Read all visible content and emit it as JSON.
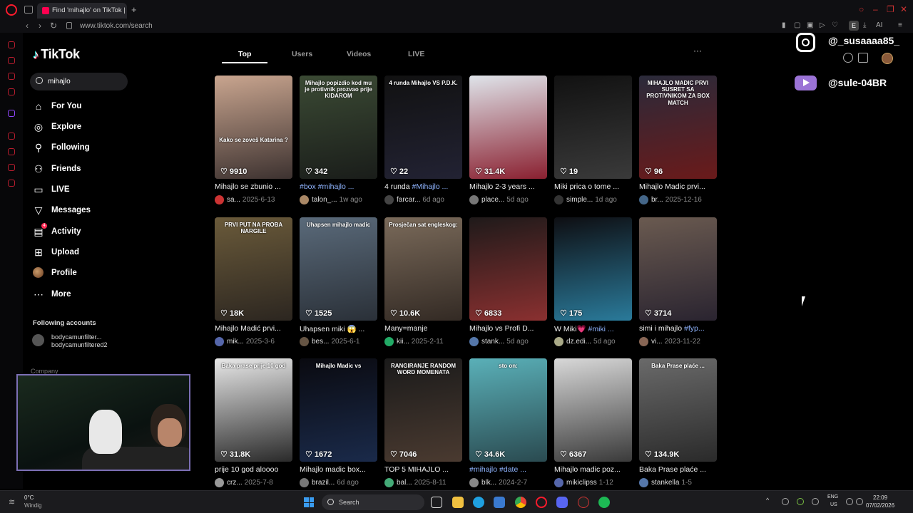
{
  "browser": {
    "tab_title": "Find 'mihajlo' on TikTok | T",
    "new_tab_symbol": "+",
    "url": "www.tiktok.com/search",
    "ext_label": "E",
    "ai_label": "AI"
  },
  "tiktok": {
    "logo_text": "TikTok",
    "search_value": "mihajlo",
    "nav": [
      {
        "label": "For You",
        "icon": "home-icon"
      },
      {
        "label": "Explore",
        "icon": "compass-icon"
      },
      {
        "label": "Following",
        "icon": "following-icon"
      },
      {
        "label": "Friends",
        "icon": "friends-icon"
      },
      {
        "label": "LIVE",
        "icon": "live-icon"
      },
      {
        "label": "Messages",
        "icon": "messages-icon"
      },
      {
        "label": "Activity",
        "icon": "activity-icon",
        "badge": "4"
      },
      {
        "label": "Upload",
        "icon": "upload-icon"
      },
      {
        "label": "Profile",
        "icon": "profile-avatar"
      },
      {
        "label": "More",
        "icon": "more-icon"
      }
    ],
    "following_title": "Following accounts",
    "following_account": {
      "name": "bodycamunfilter...",
      "handle": "bodycamunfiltered2"
    },
    "company_label": "Company",
    "tabs": [
      "Top",
      "Users",
      "Videos",
      "LIVE"
    ],
    "active_tab": "Top",
    "more_label": "···"
  },
  "videos": [
    {
      "likes": "9910",
      "title": "Mihajlo se zbunio ...",
      "tag": "",
      "author": "sa...",
      "date": "2025-6-13",
      "overlay": "Kako se zoveš Katarina ?",
      "colors": [
        "#c9a58f",
        "#3d3230"
      ],
      "ava": "#c33"
    },
    {
      "likes": "342",
      "title": "",
      "tag": "#box #mihajlo ...",
      "author": "talon_...",
      "date": "1w ago",
      "overlay": "Mihajlo popizdio kod mu je protivnik prozvao prije KIDAROM",
      "colors": [
        "#3b4a34",
        "#1a1d1a"
      ],
      "ava": "#a86"
    },
    {
      "likes": "22",
      "title": "4 runda ",
      "tag": "#Mihajlo ...",
      "author": "farcar...",
      "date": "6d ago",
      "overlay": "4 runda Mihajlo VS P.D.K.",
      "colors": [
        "#111",
        "#223"
      ],
      "ava": "#444"
    },
    {
      "likes": "31.4K",
      "title": "Mihajlo 2-3 years ...",
      "tag": "",
      "author": "place...",
      "date": "5d ago",
      "overlay": "",
      "colors": [
        "#dfe4ea",
        "#8a2030"
      ],
      "ava": "#777"
    },
    {
      "likes": "19",
      "title": "Miki prica o tome ...",
      "tag": "",
      "author": "simple...",
      "date": "1d ago",
      "overlay": "",
      "colors": [
        "#111",
        "#3a3a3a"
      ],
      "ava": "#333"
    },
    {
      "likes": "96",
      "title": "Mihajlo Madic prvi...",
      "tag": "",
      "author": "br...",
      "date": "2025-12-16",
      "overlay": "MIHAJLO MADIC PRVI SUSRET SA PROTIVNIKOM ZA BOX MATCH",
      "colors": [
        "#2a2a3a",
        "#6a1a1a"
      ],
      "ava": "#468"
    },
    {
      "likes": "18K",
      "title": "Mihajlo Madić prvi...",
      "tag": "",
      "author": "mik...",
      "date": "2025-3-6",
      "overlay": "PRVI PUT NA PROBA NARGILE",
      "colors": [
        "#6a5a3a",
        "#2c2620"
      ],
      "ava": "#56a"
    },
    {
      "likes": "1525",
      "title": "Uhapsen miki 😱 ...",
      "tag": "",
      "author": "bes...",
      "date": "2025-6-1",
      "overlay": "Uhapsen mihajlo madic",
      "colors": [
        "#5a6a7a",
        "#2a3038"
      ],
      "ava": "#654"
    },
    {
      "likes": "10.6K",
      "title": "Many=manje",
      "tag": "",
      "author": "kii...",
      "date": "2025-2-11",
      "overlay": "Prosječan sat engleskog:",
      "colors": [
        "#7a6a5a",
        "#332a24"
      ],
      "ava": "#2a6"
    },
    {
      "likes": "6833",
      "title": "Mihajlo vs Profi D...",
      "tag": "",
      "author": "stank...",
      "date": "5d ago",
      "overlay": "",
      "colors": [
        "#1f1a1a",
        "#8a3030"
      ],
      "ava": "#57a"
    },
    {
      "likes": "175",
      "title": "W Miki💗 ",
      "tag": "#miki ...",
      "author": "dz.edi...",
      "date": "5d ago",
      "overlay": "",
      "colors": [
        "#0e0e12",
        "#2a7a9a"
      ],
      "ava": "#aa8"
    },
    {
      "likes": "3714",
      "title": "simi i mihajlo ",
      "tag": "#fyp...",
      "author": "vi...",
      "date": "2023-11-22",
      "overlay": "",
      "colors": [
        "#6a5a50",
        "#2a2430"
      ],
      "ava": "#865"
    },
    {
      "likes": "31.8K",
      "title": "prije 10 god aloooo",
      "tag": "",
      "author": "crz...",
      "date": "2025-7-8",
      "overlay": "Baka prase prije 10 god",
      "colors": [
        "#e8e8e8",
        "#2a2a2a"
      ],
      "ava": "#999"
    },
    {
      "likes": "1672",
      "title": "Mihajlo madic box...",
      "tag": "",
      "author": "brazil...",
      "date": "6d ago",
      "overlay": "Mihajlo Madic vs",
      "colors": [
        "#0a0a10",
        "#1a2a4a"
      ],
      "ava": "#777"
    },
    {
      "likes": "7046",
      "title": "TOP 5 MIHAJLO ...",
      "tag": "",
      "author": "bal...",
      "date": "2025-8-11",
      "overlay": "RANGIRANJE RANDOM WORD MOMENATA",
      "colors": [
        "#1a1a1a",
        "#4a3a30"
      ],
      "ava": "#4a7"
    },
    {
      "likes": "34.6K",
      "title": "",
      "tag": "#mihajlo #date ...",
      "author": "blk...",
      "date": "2024-2-7",
      "overlay": "sto on:",
      "colors": [
        "#5ab0b8",
        "#2a4a50"
      ],
      "ava": "#888"
    },
    {
      "likes": "6367",
      "title": "Mihajlo madic poz...",
      "tag": "",
      "author": "mikiclipss",
      "date": "1-12",
      "overlay": "",
      "colors": [
        "#d8d8d8",
        "#3a3a3a"
      ],
      "ava": "#56a"
    },
    {
      "likes": "134.9K",
      "title": "Baka Prase plaće ...",
      "tag": "",
      "author": "stankella",
      "date": "1-5",
      "overlay": "Baka Prase plaće ...",
      "colors": [
        "#6a6a6a",
        "#2a2a2a"
      ],
      "ava": "#57a"
    }
  ],
  "stream_overlay": {
    "instagram_handle": "@_susaaaa85_",
    "youtube_handle": "@sule-04BR"
  },
  "taskbar": {
    "weather_temp": "0°C",
    "weather_cond": "Windig",
    "search_placeholder": "Search",
    "lang1": "ENG",
    "lang2": "US",
    "time": "22:09",
    "date": "07/02/2026"
  }
}
